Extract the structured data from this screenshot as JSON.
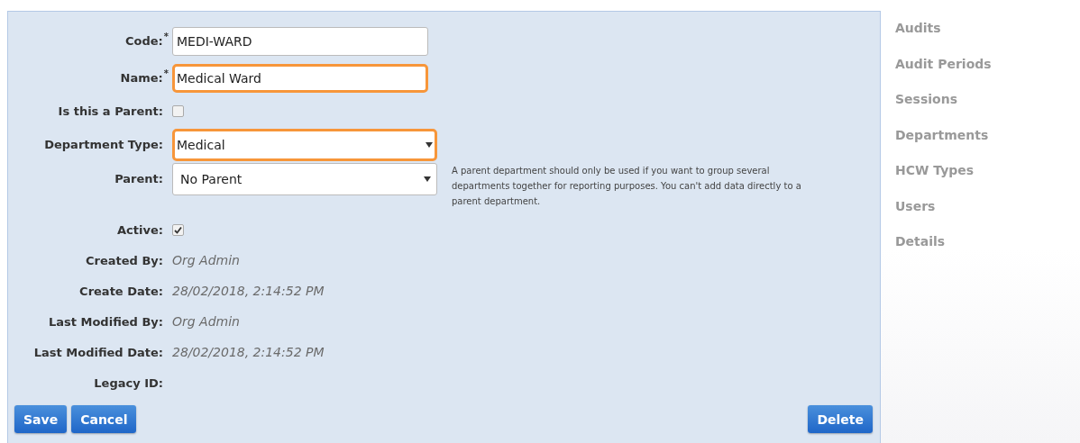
{
  "form": {
    "fields": [
      {
        "kind": "text",
        "label": "Code:",
        "required_mark": "*",
        "value": "MEDI-WARD",
        "highlighted": false
      },
      {
        "kind": "text",
        "label": "Name:",
        "required_mark": "*",
        "value": "Medical Ward",
        "highlighted": true
      },
      {
        "kind": "checkbox",
        "label": "Is this a Parent:",
        "checked": false
      },
      {
        "kind": "select",
        "label": "Department Type:",
        "value": "Medical",
        "highlighted": true
      },
      {
        "kind": "select",
        "label": "Parent:",
        "value": "No Parent",
        "highlighted": false,
        "help": "A parent department should only be used if you want to group several departments together for reporting purposes. You can't add data directly to a parent department."
      },
      {
        "kind": "checkbox",
        "label": "Active:",
        "checked": true
      },
      {
        "kind": "readonly",
        "label": "Created By:",
        "value": "Org Admin"
      },
      {
        "kind": "readonly",
        "label": "Create Date:",
        "value": "28/02/2018, 2:14:52 PM"
      },
      {
        "kind": "readonly",
        "label": "Last Modified By:",
        "value": "Org Admin"
      },
      {
        "kind": "readonly",
        "label": "Last Modified Date:",
        "value": "28/02/2018, 2:14:52 PM"
      },
      {
        "kind": "readonly",
        "label": "Legacy ID:"
      }
    ],
    "buttons_left": [
      "Save",
      "Cancel"
    ],
    "buttons_right": [
      "Delete"
    ]
  },
  "sidebar": {
    "items": [
      "Audits",
      "Audit Periods",
      "Sessions",
      "Departments",
      "HCW Types",
      "Users",
      "Details"
    ]
  }
}
